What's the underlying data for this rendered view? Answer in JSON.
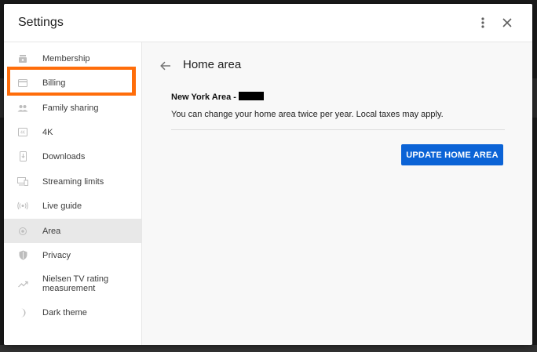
{
  "dialog": {
    "title": "Settings"
  },
  "sidebar": {
    "items": [
      {
        "label": "Membership",
        "icon": "membership-icon"
      },
      {
        "label": "Billing",
        "icon": "credit-card-icon"
      },
      {
        "label": "Family sharing",
        "icon": "people-icon"
      },
      {
        "label": "4K",
        "icon": "4k-icon"
      },
      {
        "label": "Downloads",
        "icon": "phone-download-icon"
      },
      {
        "label": "Streaming limits",
        "icon": "devices-icon"
      },
      {
        "label": "Live guide",
        "icon": "broadcast-icon"
      },
      {
        "label": "Area",
        "icon": "location-icon",
        "active": true
      },
      {
        "label": "Privacy",
        "icon": "shield-icon"
      },
      {
        "label": "Nielsen TV rating measurement",
        "icon": "trending-icon"
      },
      {
        "label": "Dark theme",
        "icon": "moon-icon"
      }
    ]
  },
  "main": {
    "title": "Home area",
    "area_name": "New York Area -",
    "note": "You can change your home area twice per year. Local taxes may apply.",
    "update_button": "UPDATE HOME AREA"
  },
  "colors": {
    "accent": "#0b63d6",
    "highlight": "#ff6d0a",
    "active_bg": "#e8e8e8"
  }
}
